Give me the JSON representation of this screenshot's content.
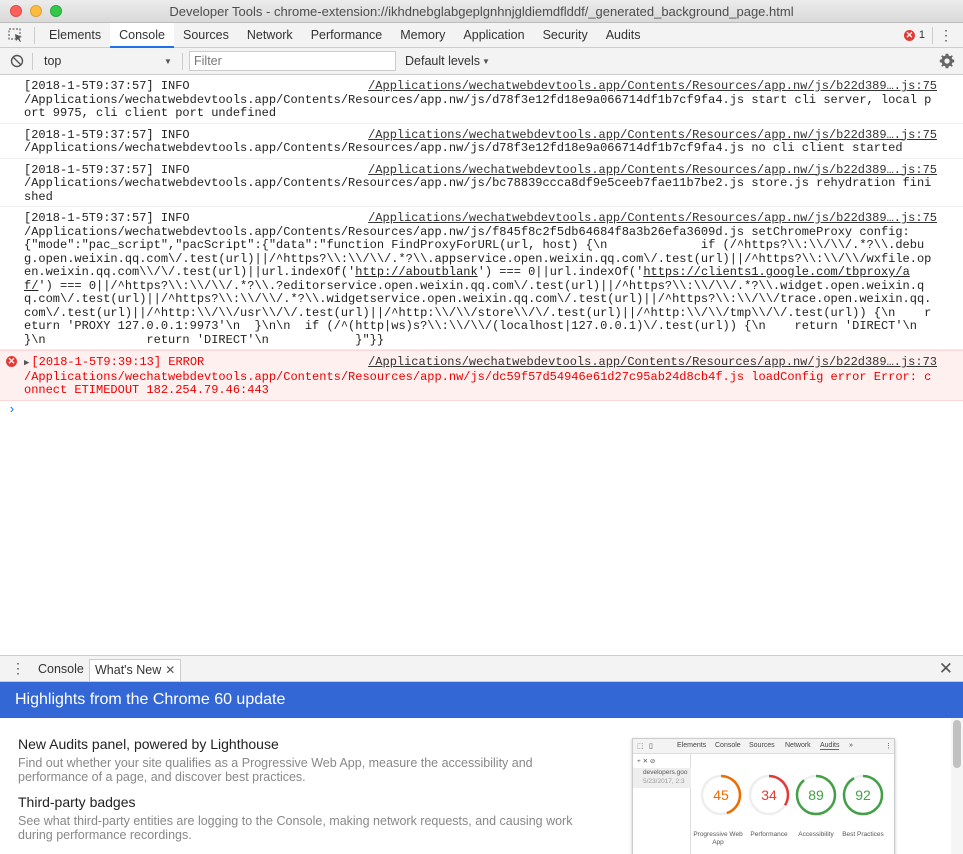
{
  "window": {
    "title": "Developer Tools - chrome-extension://ikhdnebglabgeplgnhnjgldiemdflddf/_generated_background_page.html"
  },
  "tabs": [
    "Elements",
    "Console",
    "Sources",
    "Network",
    "Performance",
    "Memory",
    "Application",
    "Security",
    "Audits"
  ],
  "active_tab": "Console",
  "error_count": "1",
  "toolbar": {
    "context": "top",
    "filter_placeholder": "Filter",
    "levels": "Default levels"
  },
  "messages": [
    {
      "head": "[2018-1-5T9:37:57] INFO",
      "source": "/Applications/wechatwebdevtools.app/Contents/Resources/app.nw/js/b22d389….js:75",
      "body": "/Applications/wechatwebdevtools.app/Contents/Resources/app.nw/js/d78f3e12fd18e9a066714df1b7cf9fa4.js start cli server, local port 9975, cli client port undefined"
    },
    {
      "head": "[2018-1-5T9:37:57] INFO",
      "source": "/Applications/wechatwebdevtools.app/Contents/Resources/app.nw/js/b22d389….js:75",
      "body": "/Applications/wechatwebdevtools.app/Contents/Resources/app.nw/js/d78f3e12fd18e9a066714df1b7cf9fa4.js no cli client started"
    },
    {
      "head": "[2018-1-5T9:37:57] INFO",
      "source": "/Applications/wechatwebdevtools.app/Contents/Resources/app.nw/js/b22d389….js:75",
      "body": "/Applications/wechatwebdevtools.app/Contents/Resources/app.nw/js/bc78839ccca8df9e5ceeb7fae11b7be2.js store.js rehydration finished"
    },
    {
      "head": "[2018-1-5T9:37:57] INFO",
      "source": "/Applications/wechatwebdevtools.app/Contents/Resources/app.nw/js/b22d389….js:75",
      "body_pre": "/Applications/wechatwebdevtools.app/Contents/Resources/app.nw/js/f845f8c2f5db64684f8a3b26efa3609d.js setChromeProxy config:\n{\"mode\":\"pac_script\",\"pacScript\":{\"data\":\"function FindProxyForURL(url, host) {\\n             if (/^https?\\\\:\\\\/\\\\/.*?\\\\.debug.open.weixin.qq.com\\/.test(url)||/^https?\\\\:\\\\/\\\\/.*?\\\\.appservice.open.weixin.qq.com\\/.test(url)||/^https?\\\\:\\\\/\\\\/wxfile.open.weixin.qq.com\\\\/\\/.test(url)||url.indexOf('",
      "link1": "http://aboutblank",
      "body_mid": "') === 0||url.indexOf('",
      "link2": "https://clients1.google.com/tbproxy/af/",
      "body_post": "') === 0||/^https?\\\\:\\\\/\\\\/.*?\\\\.?editorservice.open.weixin.qq.com\\/.test(url)||/^https?\\\\:\\\\/\\\\/.*?\\\\.widget.open.weixin.qq.com\\/.test(url)||/^https?\\\\:\\\\/\\\\/.*?\\\\.widgetservice.open.weixin.qq.com\\/.test(url)||/^https?\\\\:\\\\/\\\\/trace.open.weixin.qq.com\\/.test(url)||/^http:\\\\/\\\\/usr\\\\/\\/.test(url)||/^http:\\\\/\\\\/store\\\\/\\/.test(url)||/^http:\\\\/\\\\/tmp\\\\/\\/.test(url)) {\\n    return 'PROXY 127.0.0.1:9973'\\n  }\\n\\n  if (/^(http|ws)s?\\\\:\\\\/\\\\/(localhost|127.0.0.1)\\/.test(url)) {\\n    return 'DIRECT'\\n  }\\n              return 'DIRECT'\\n            }\"}}"
    },
    {
      "head": "[2018-1-5T9:39:13] ERROR",
      "source": "/Applications/wechatwebdevtools.app/Contents/Resources/app.nw/js/b22d389….js:73",
      "body": "/Applications/wechatwebdevtools.app/Contents/Resources/app.nw/js/dc59f57d54946e61d27c95ab24d8cb4f.js loadConfig error Error: connect ETIMEDOUT 182.254.79.46:443"
    }
  ],
  "drawer": {
    "tabs": [
      "Console",
      "What's New"
    ],
    "active": "What's New"
  },
  "whats_new": {
    "banner": "Highlights from the Chrome 60 update",
    "items": [
      {
        "title": "New Audits panel, powered by Lighthouse",
        "desc": "Find out whether your site qualifies as a Progressive Web App, measure the accessibility and performance of a page, and discover best practices."
      },
      {
        "title": "Third-party badges",
        "desc": "See what third-party entities are logging to the Console, making network requests, and causing work during performance recordings."
      }
    ],
    "preview": {
      "tabs": [
        "Elements",
        "Console",
        "Sources",
        "Network",
        "Audits",
        "»"
      ],
      "site": "developers.goo",
      "date": "5/23/2017, 2:3",
      "scores": [
        {
          "value": "45",
          "label": "Progressive Web App",
          "color": "#ef6c00"
        },
        {
          "value": "34",
          "label": "Performance",
          "color": "#e53935"
        },
        {
          "value": "89",
          "label": "Accessibility",
          "color": "#43a047"
        },
        {
          "value": "92",
          "label": "Best Practices",
          "color": "#43a047"
        }
      ]
    }
  }
}
